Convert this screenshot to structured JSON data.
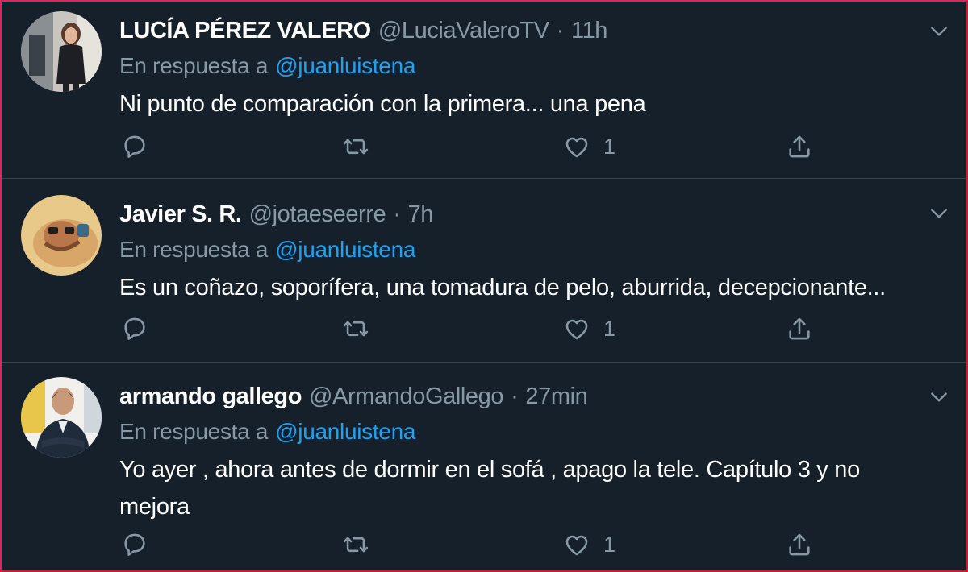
{
  "tweets": [
    {
      "name": "LUCÍA PÉREZ VALERO",
      "handle": "@LuciaValeroTV",
      "separator": "·",
      "time": "11h",
      "reply_prefix": "En respuesta a",
      "reply_to": "@juanluistena",
      "text": "Ni punto de comparación con la primera... una pena",
      "likes": "1"
    },
    {
      "name": "Javier S. R.",
      "handle": "@jotaeseerre",
      "separator": "·",
      "time": "7h",
      "reply_prefix": "En respuesta a",
      "reply_to": "@juanluistena",
      "text": "Es un coñazo, soporífera, una tomadura de pelo, aburrida, decepcionante...",
      "likes": "1"
    },
    {
      "name": "armando gallego",
      "handle": "@ArmandoGallego",
      "separator": "·",
      "time": "27min",
      "reply_prefix": "En respuesta a",
      "reply_to": "@juanluistena",
      "text": "Yo ayer , ahora antes de dormir en el sofá , apago la tele. Capítulo 3 y no mejora",
      "likes": "1"
    }
  ],
  "icons": {
    "reply": "reply-icon",
    "retweet": "retweet-icon",
    "like": "heart-icon",
    "share": "share-icon",
    "more": "chevron-down-icon"
  },
  "colors": {
    "background": "#15202b",
    "divider": "#38444d",
    "secondary_text": "#8899a6",
    "link": "#1da1f2",
    "frame": "#e0245e"
  }
}
